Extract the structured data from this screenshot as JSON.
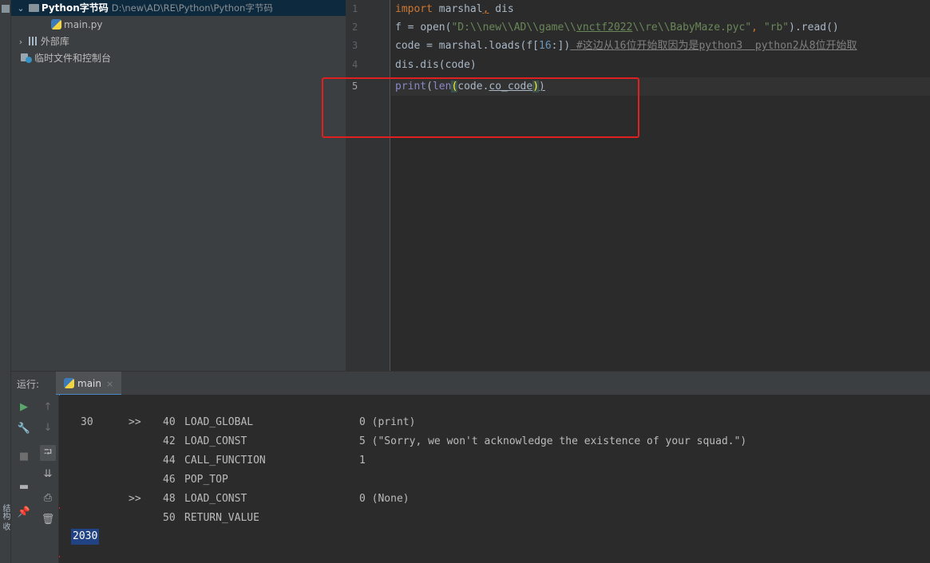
{
  "project_tree": {
    "root": {
      "name": "Python字节码",
      "path": "D:\\new\\AD\\RE\\Python\\Python字节码"
    },
    "file": "main.py",
    "external_libs": "外部库",
    "scratches": "临时文件和控制台"
  },
  "editor": {
    "line_numbers": [
      "1",
      "2",
      "3",
      "4",
      "5"
    ],
    "lines": {
      "l1": {
        "kw": "import",
        "mid": " marshal",
        "comma": ",",
        "rest": " dis"
      },
      "l2": {
        "a": "f = ",
        "open": "open",
        "p1": "(",
        "s1": "\"D:\\\\new\\\\AD\\\\game\\\\",
        "s1b": "vnctf2022",
        "s1c": "\\\\re\\\\BabyMaze.pyc\"",
        "c": ", ",
        "s2": "\"rb\"",
        "end": ").read()"
      },
      "l3": {
        "a": "code = marshal.loads(f[",
        "n": "16",
        "b": ":])",
        "cmt": " #这边从16位开始取因为是python3  python2从8位开始取"
      },
      "l4": {
        "a": "dis.dis(code)"
      },
      "l5": {
        "fn": "print",
        "p1": "(",
        "len": "len",
        "b1": "(",
        "mid": "code.",
        "attr": "co_code",
        "b2": ")",
        "p2": ")"
      }
    }
  },
  "run_panel": {
    "label": "运行:",
    "tab": "main",
    "tab_close": "×",
    "output": [
      {
        "lineno": "30",
        "marker": ">>",
        "offset": "40",
        "op": "LOAD_GLOBAL",
        "arg": "0 (print)"
      },
      {
        "lineno": "",
        "marker": "",
        "offset": "42",
        "op": "LOAD_CONST",
        "arg": "5 (\"Sorry, we won't acknowledge the existence of your squad.\")"
      },
      {
        "lineno": "",
        "marker": "",
        "offset": "44",
        "op": "CALL_FUNCTION",
        "arg": "1"
      },
      {
        "lineno": "",
        "marker": "",
        "offset": "46",
        "op": "POP_TOP",
        "arg": ""
      },
      {
        "lineno": "",
        "marker": ">>",
        "offset": "48",
        "op": "LOAD_CONST",
        "arg": "0 (None)"
      },
      {
        "lineno": "",
        "marker": "",
        "offset": "50",
        "op": "RETURN_VALUE",
        "arg": ""
      }
    ],
    "result": "2030"
  },
  "side_strip_label": "结构 收"
}
